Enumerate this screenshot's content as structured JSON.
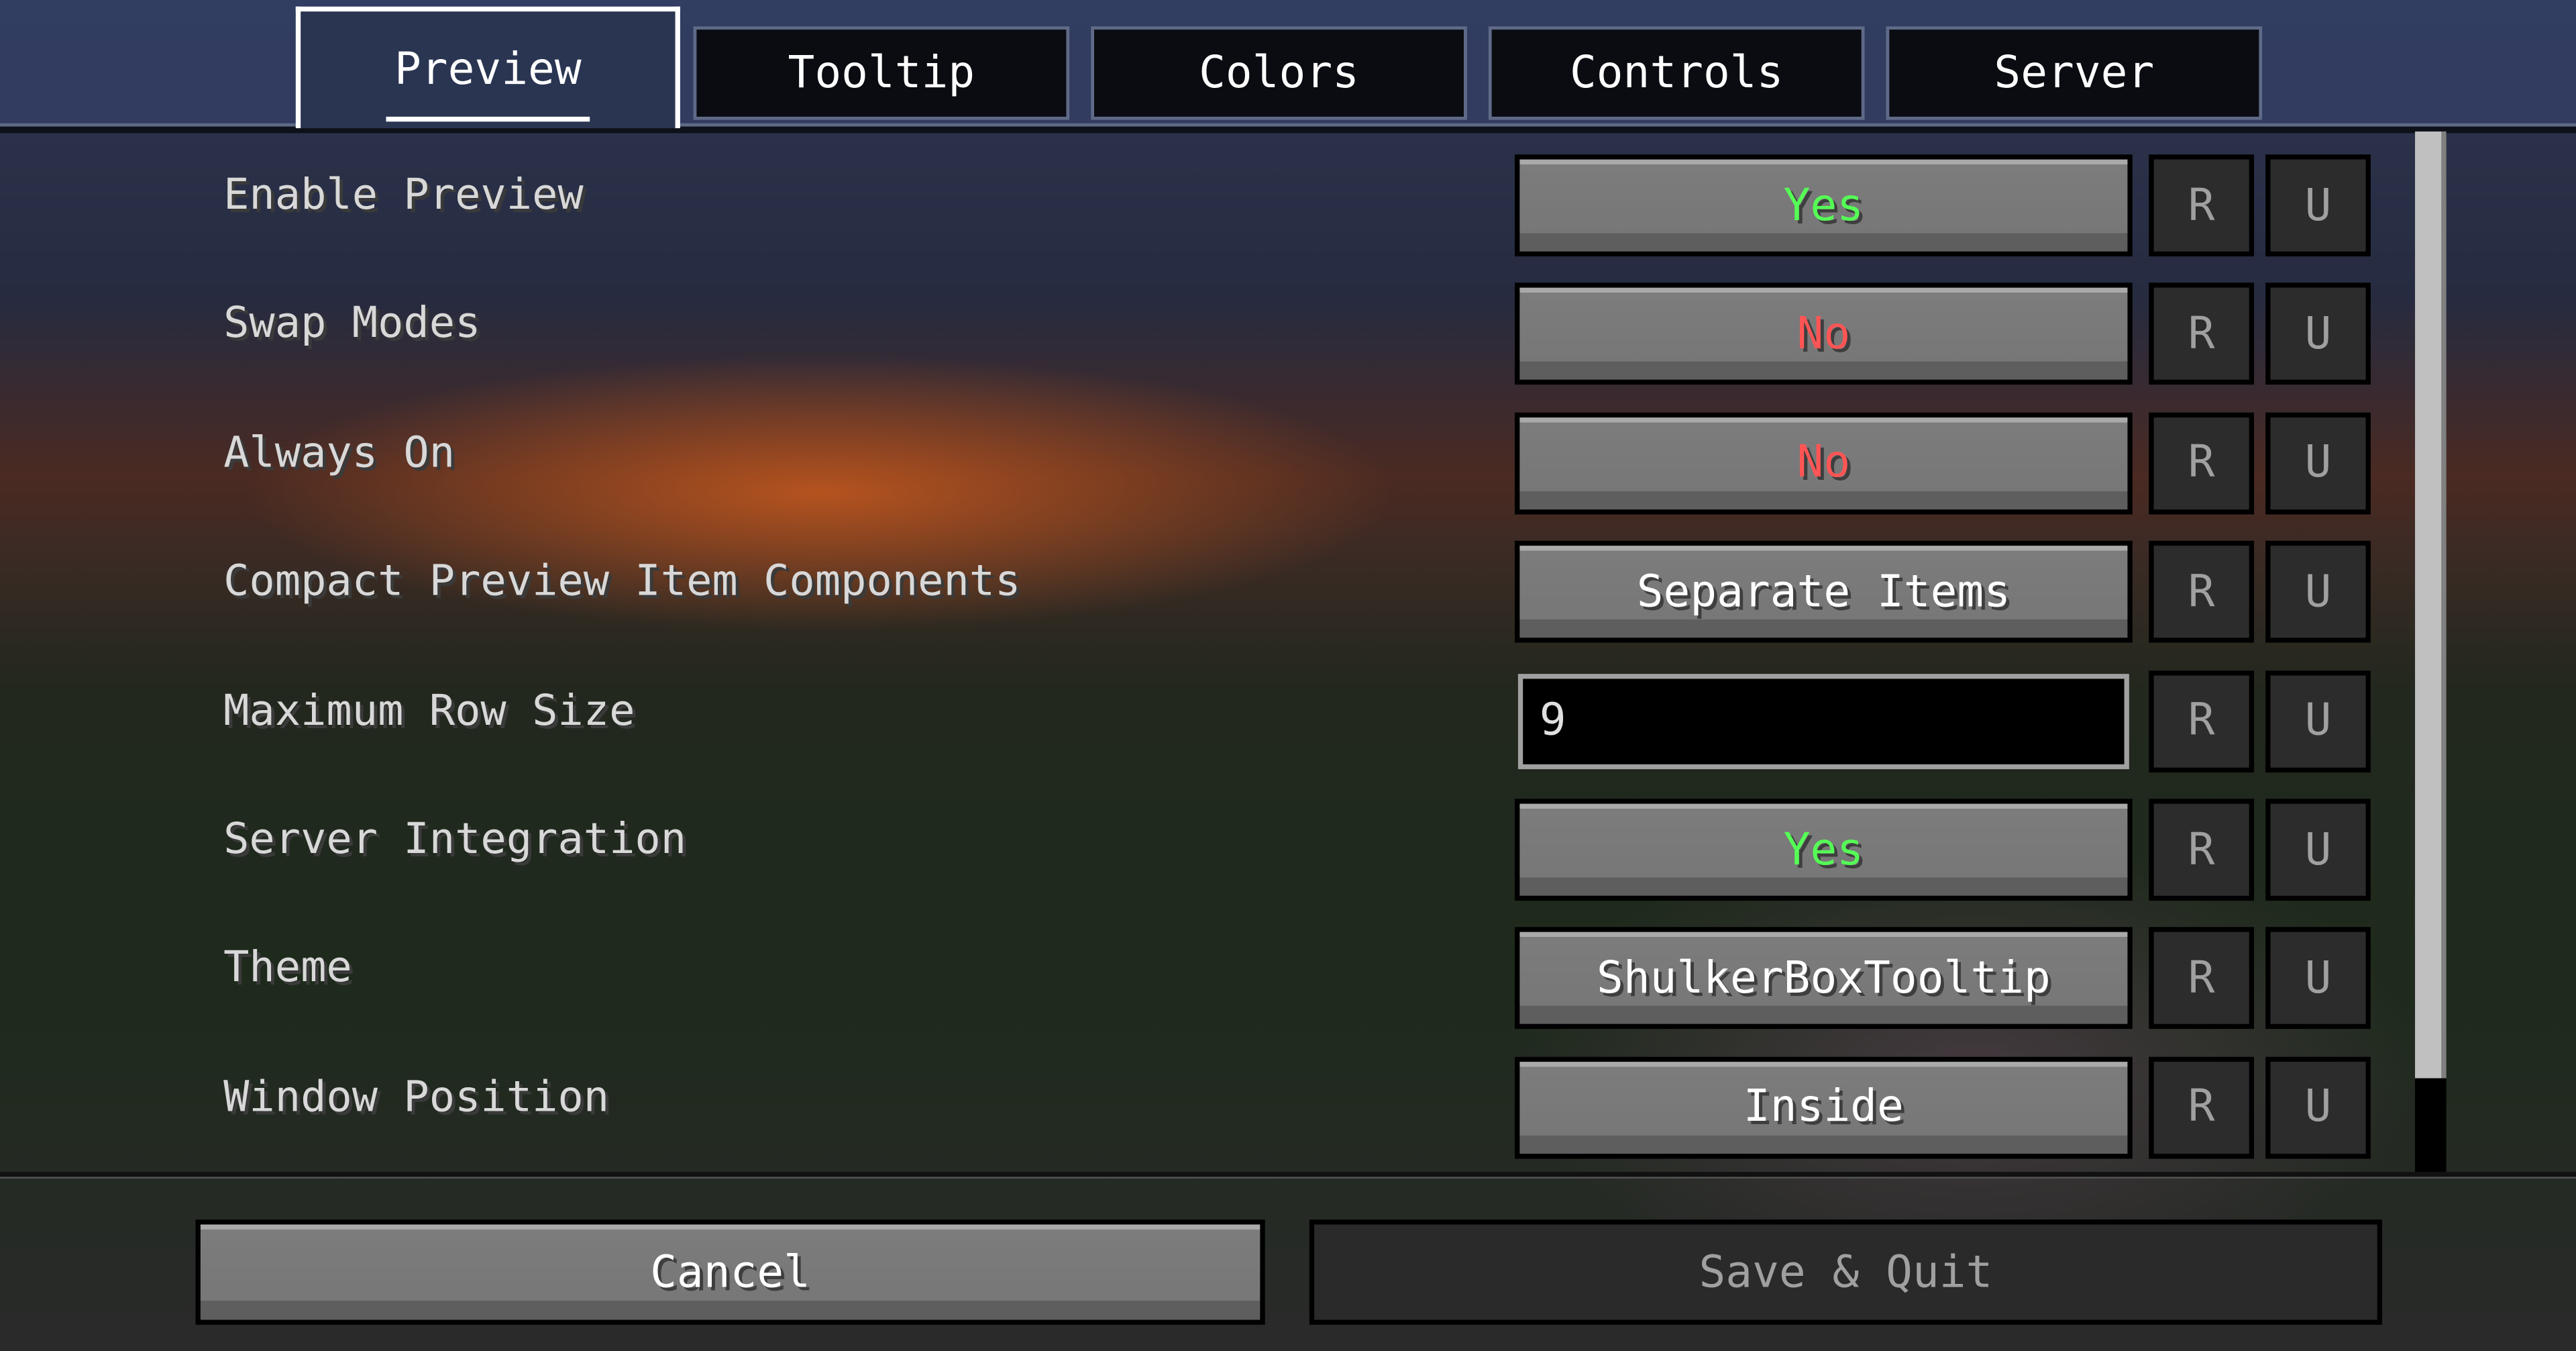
{
  "tabs": [
    {
      "label": "Preview",
      "selected": true
    },
    {
      "label": "Tooltip"
    },
    {
      "label": "Colors"
    },
    {
      "label": "Controls"
    },
    {
      "label": "Server"
    }
  ],
  "rows": [
    {
      "label": "Enable Preview",
      "type": "button",
      "value": "Yes",
      "color": "#55ff55"
    },
    {
      "label": "Swap Modes",
      "type": "button",
      "value": "No",
      "color": "#ff5555"
    },
    {
      "label": "Always On",
      "type": "button",
      "value": "No",
      "color": "#ff5555"
    },
    {
      "label": "Compact Preview Item Components",
      "type": "button",
      "value": "Separate Items",
      "color": "#ffffff"
    },
    {
      "label": "Maximum Row Size",
      "type": "input",
      "value": "9"
    },
    {
      "label": "Server Integration",
      "type": "button",
      "value": "Yes",
      "color": "#55ff55"
    },
    {
      "label": "Theme",
      "type": "button",
      "value": "ShulkerBoxTooltip",
      "color": "#ffffff"
    },
    {
      "label": "Window Position",
      "type": "button",
      "value": "Inside",
      "color": "#ffffff"
    }
  ],
  "reset_label": "R",
  "undo_label": "U",
  "footer": {
    "cancel": "Cancel",
    "save": "Save & Quit",
    "save_enabled": false
  }
}
